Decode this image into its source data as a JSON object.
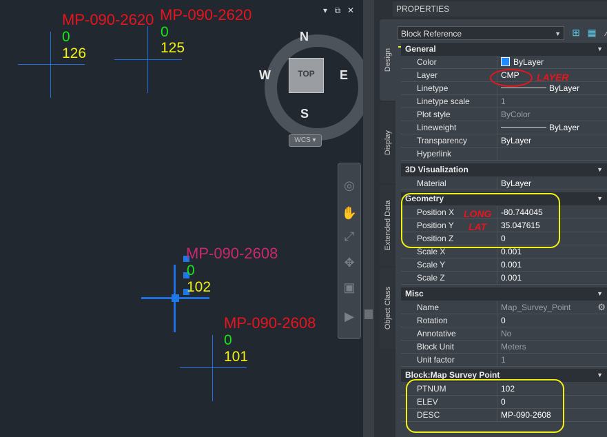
{
  "window_controls": {
    "minimize": "▾",
    "restore": "⧉",
    "close": "✕"
  },
  "points": [
    {
      "desc": "MP-090-2620",
      "elev": "0",
      "ptnum": "126"
    },
    {
      "desc": "MP-090-2620",
      "elev": "0",
      "ptnum": "125"
    },
    {
      "desc": "MP-090-2608",
      "elev": "0",
      "ptnum": "102",
      "selected": true
    },
    {
      "desc": "MP-090-2608",
      "elev": "0",
      "ptnum": "101"
    }
  ],
  "viewcube": {
    "north": "N",
    "south": "S",
    "east": "E",
    "west": "W",
    "face": "TOP",
    "ucs": "WCS"
  },
  "navbar_icons": [
    "steeringwheel-icon",
    "pan-icon",
    "zoom-extents-icon",
    "orbit-icon",
    "showmotion-icon"
  ],
  "palette": {
    "title": "PROPERTIES",
    "object_type": "Block Reference",
    "tabs": [
      "Design",
      "Display",
      "Extended Data",
      "Object Class"
    ],
    "sections": {
      "general": "General",
      "viz": "3D Visualization",
      "geometry": "Geometry",
      "misc": "Misc",
      "block": "Block:Map Survey Point"
    },
    "general_rows": [
      {
        "name": "Color",
        "value": "ByLayer"
      },
      {
        "name": "Layer",
        "value": "CMP"
      },
      {
        "name": "Linetype",
        "value": "ByLayer"
      },
      {
        "name": "Linetype scale",
        "value": "1"
      },
      {
        "name": "Plot style",
        "value": "ByColor"
      },
      {
        "name": "Lineweight",
        "value": "ByLayer"
      },
      {
        "name": "Transparency",
        "value": "ByLayer"
      },
      {
        "name": "Hyperlink",
        "value": ""
      }
    ],
    "viz_rows": [
      {
        "name": "Material",
        "value": "ByLayer"
      }
    ],
    "geometry_rows": [
      {
        "name": "Position X",
        "value": "-80.744045"
      },
      {
        "name": "Position Y",
        "value": "35.047615"
      },
      {
        "name": "Position Z",
        "value": "0"
      },
      {
        "name": "Scale X",
        "value": "0.001"
      },
      {
        "name": "Scale Y",
        "value": "0.001"
      },
      {
        "name": "Scale Z",
        "value": "0.001"
      }
    ],
    "misc_rows": [
      {
        "name": "Name",
        "value": "Map_Survey_Point"
      },
      {
        "name": "Rotation",
        "value": "0"
      },
      {
        "name": "Annotative",
        "value": "No"
      },
      {
        "name": "Block Unit",
        "value": "Meters"
      },
      {
        "name": "Unit factor",
        "value": "1"
      }
    ],
    "block_rows": [
      {
        "name": "PTNUM",
        "value": "102"
      },
      {
        "name": "ELEV",
        "value": "0"
      },
      {
        "name": "DESC",
        "value": "MP-090-2608"
      }
    ]
  },
  "annotations": {
    "layer": "LAYER",
    "long": "LONG",
    "lat": "LAT"
  },
  "colors": {
    "highlight": "#f0f014",
    "annotation": "#e8141e",
    "crosshair": "#1e6ee6"
  }
}
